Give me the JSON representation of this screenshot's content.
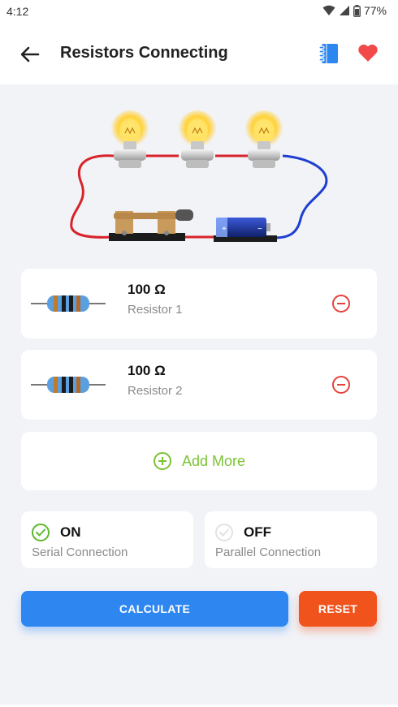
{
  "status_bar": {
    "time": "4:12",
    "battery": "77%"
  },
  "header": {
    "title": "Resistors Connecting"
  },
  "resistors": [
    {
      "value": "100 Ω",
      "name": "Resistor 1"
    },
    {
      "value": "100 Ω",
      "name": "Resistor 2"
    }
  ],
  "add_more_label": "Add More",
  "connections": {
    "serial": {
      "state": "ON",
      "label": "Serial Connection",
      "checked": true
    },
    "parallel": {
      "state": "OFF",
      "label": "Parallel Connection",
      "checked": false
    }
  },
  "buttons": {
    "calculate": "CALCULATE",
    "reset": "RESET"
  },
  "colors": {
    "primary": "#2e86f0",
    "accent": "#f0531c",
    "remove": "#e8403b",
    "add": "#7cc233",
    "heart": "#f24a4a"
  }
}
